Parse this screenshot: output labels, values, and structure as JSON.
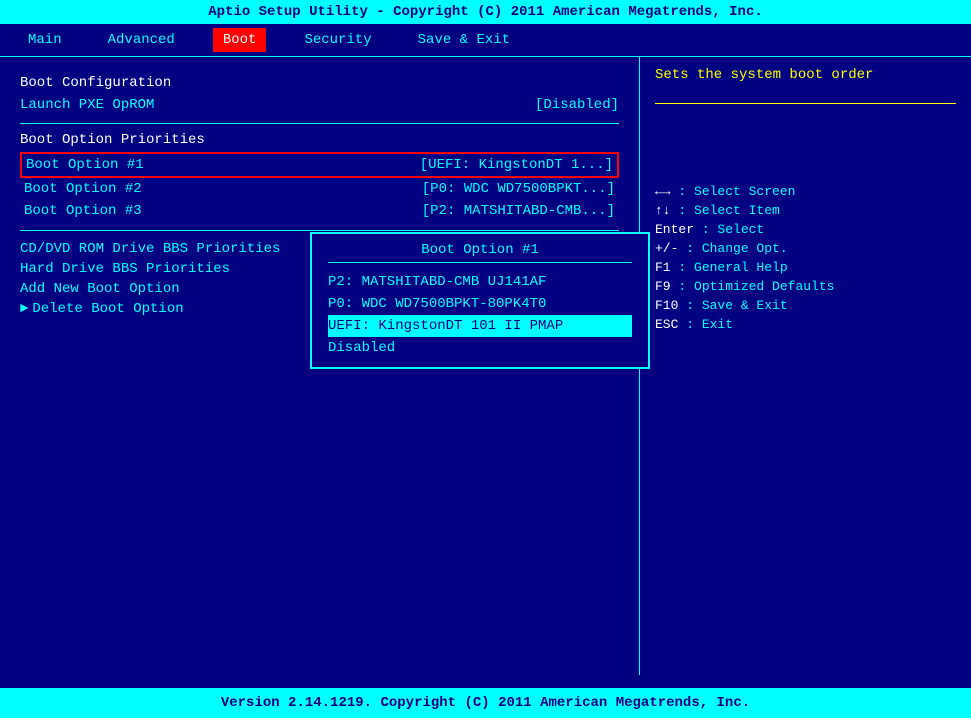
{
  "title_bar": {
    "text": "Aptio Setup Utility - Copyright (C) 2011 American Megatrends, Inc."
  },
  "menu": {
    "items": [
      {
        "id": "main",
        "label": "Main",
        "active": false
      },
      {
        "id": "advanced",
        "label": "Advanced",
        "active": false
      },
      {
        "id": "boot",
        "label": "Boot",
        "active": true
      },
      {
        "id": "security",
        "label": "Security",
        "active": false
      },
      {
        "id": "save-exit",
        "label": "Save & Exit",
        "active": false
      }
    ]
  },
  "left_panel": {
    "section1_title": "Boot Configuration",
    "launch_pxe_label": "Launch PXE OpROM",
    "launch_pxe_value": "[Disabled]",
    "section2_title": "Boot Option Priorities",
    "boot_options": [
      {
        "label": "Boot Option #1",
        "value": "[UEFI: KingstonDT 1...]",
        "selected": true
      },
      {
        "label": "Boot Option #2",
        "value": "[P0: WDC WD7500BPKT...]"
      },
      {
        "label": "Boot Option #3",
        "value": "[P2: MATSHITABD-CMB...]"
      }
    ],
    "links": [
      {
        "label": "CD/DVD ROM Drive BBS Priorities",
        "has_arrow": false
      },
      {
        "label": "Hard Drive BBS Priorities",
        "has_arrow": false
      },
      {
        "label": "Add New Boot Option",
        "has_arrow": false
      },
      {
        "label": "Delete Boot Option",
        "has_arrow": true
      }
    ]
  },
  "dropdown": {
    "title": "Boot Option #1",
    "items": [
      {
        "label": "P2: MATSHITABD-CMB UJ141AF",
        "highlighted": false
      },
      {
        "label": "P0: WDC WD7500BPKT-80PK4T0",
        "highlighted": false
      },
      {
        "label": "UEFI: KingstonDT 101 II PMAP",
        "highlighted": true
      },
      {
        "label": "Disabled",
        "highlighted": false
      }
    ]
  },
  "right_panel": {
    "help_text": "Sets the system boot order",
    "key_hints": [
      {
        "key": "←→",
        "desc": ": Select Screen"
      },
      {
        "key": "↑↓",
        "desc": ": Select Item"
      },
      {
        "key": "Enter",
        "desc": ": Select"
      },
      {
        "key": "+/-",
        "desc": ": Change Opt."
      },
      {
        "key": "F1",
        "desc": ": General Help"
      },
      {
        "key": "F9",
        "desc": ": Optimized Defaults"
      },
      {
        "key": "F10",
        "desc": ": Save & Exit"
      },
      {
        "key": "ESC",
        "desc": ": Exit"
      }
    ]
  },
  "bottom_bar": {
    "text": "Version 2.14.1219. Copyright (C) 2011 American Megatrends, Inc."
  }
}
